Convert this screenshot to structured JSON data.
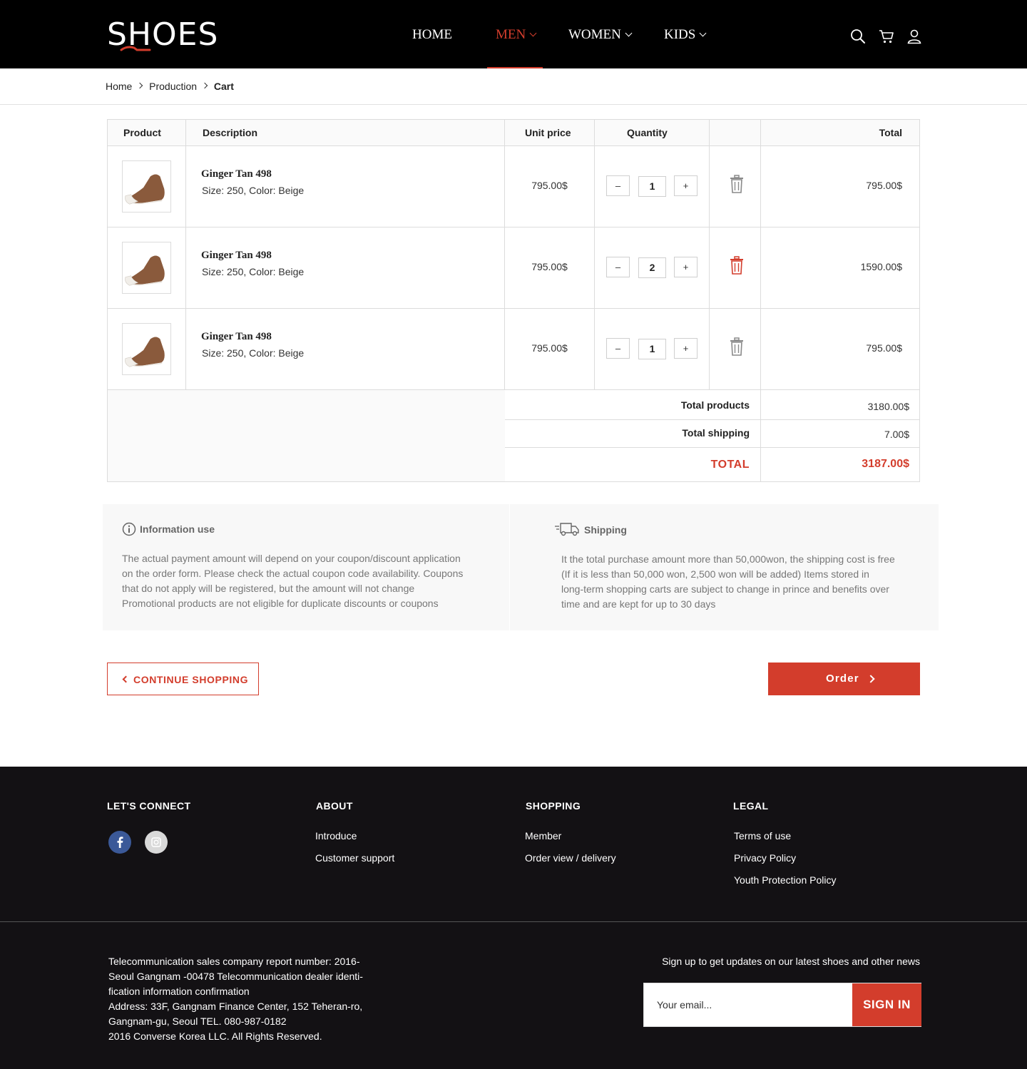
{
  "brand": {
    "logo": "SHOES",
    "accent": "#d33d2c"
  },
  "nav": {
    "items": [
      {
        "label": "HOME",
        "dropdown": false,
        "active": false
      },
      {
        "label": "MEN",
        "dropdown": true,
        "active": true
      },
      {
        "label": "WOMEN",
        "dropdown": true,
        "active": false
      },
      {
        "label": "KIDS",
        "dropdown": true,
        "active": false
      }
    ],
    "icons": [
      "search-icon",
      "cart-icon",
      "user-icon"
    ]
  },
  "breadcrumb": {
    "items": [
      "Home",
      "Production"
    ],
    "current": "Cart"
  },
  "cart": {
    "headers": {
      "product": "Product",
      "description": "Description",
      "unit_price": "Unit price",
      "quantity": "Quantity",
      "total": "Total"
    },
    "rows": [
      {
        "name": "Ginger Tan 498",
        "details": "Size: 250, Color: Beige",
        "unit_price": "795.00$",
        "qty": "1",
        "total": "795.00$",
        "trash_color": "#8a8a8a"
      },
      {
        "name": "Ginger Tan 498",
        "details": "Size: 250, Color: Beige",
        "unit_price": "795.00$",
        "qty": "2",
        "total": "1590.00$",
        "trash_color": "#d33d2c"
      },
      {
        "name": "Ginger Tan 498",
        "details": "Size: 250, Color: Beige",
        "unit_price": "795.00$",
        "qty": "1",
        "total": "795.00$",
        "trash_color": "#8a8a8a"
      }
    ],
    "minus": "–",
    "plus": "+",
    "summary": {
      "products_label": "Total products",
      "products_value": "3180.00$",
      "shipping_label": "Total shipping",
      "shipping_value": "7.00$",
      "total_label": "TOTAL",
      "total_value": "3187.00$"
    }
  },
  "info": {
    "usage": {
      "title": "Information use",
      "lines": [
        "The actual payment amount will depend on your coupon/discount application",
        "on the order form. Please check the actual coupon code availability. Coupons",
        "that do not apply will be registered, but the amount will not change",
        "Promotional products are not eligible for duplicate discounts or coupons"
      ]
    },
    "shipping": {
      "title": "Shipping",
      "lines": [
        "It the total purchase amount more than 50,000won, the shipping cost is free",
        "(If it is less than 50,000 won, 2,500 won will be added) Items stored in",
        "long-term shopping carts are subject to change in prince and benefits over",
        "time and are kept for up to 30 days"
      ]
    }
  },
  "actions": {
    "continue_label": "CONTINUE SHOPPING",
    "order_label": "Order"
  },
  "footer": {
    "connect": {
      "title": "LET'S CONNECT",
      "icons": [
        "facebook-icon",
        "instagram-icon"
      ]
    },
    "about": {
      "title": "ABOUT",
      "links": [
        "Introduce",
        "Customer support"
      ]
    },
    "shopping": {
      "title": "SHOPPING",
      "links": [
        "Member",
        "Order view / delivery"
      ]
    },
    "legal": {
      "title": "LEGAL",
      "links": [
        "Terms of use",
        "Privacy Policy",
        "Youth Protection Policy"
      ]
    },
    "company_lines": [
      "Telecommunication sales company report number: 2016-",
      "Seoul Gangnam -00478 Telecommunication dealer identi-",
      "fication information confirmation",
      "Address: 33F, Gangnam Finance Center, 152 Teheran-ro,",
      "Gangnam-gu, Seoul TEL. 080-987-0182",
      "2016 Converse Korea LLC. All Rights Reserved."
    ],
    "newsletter": {
      "text": "Sign up to get updates on our latest shoes and other news",
      "placeholder": "Your email...",
      "button": "SIGN IN"
    }
  }
}
